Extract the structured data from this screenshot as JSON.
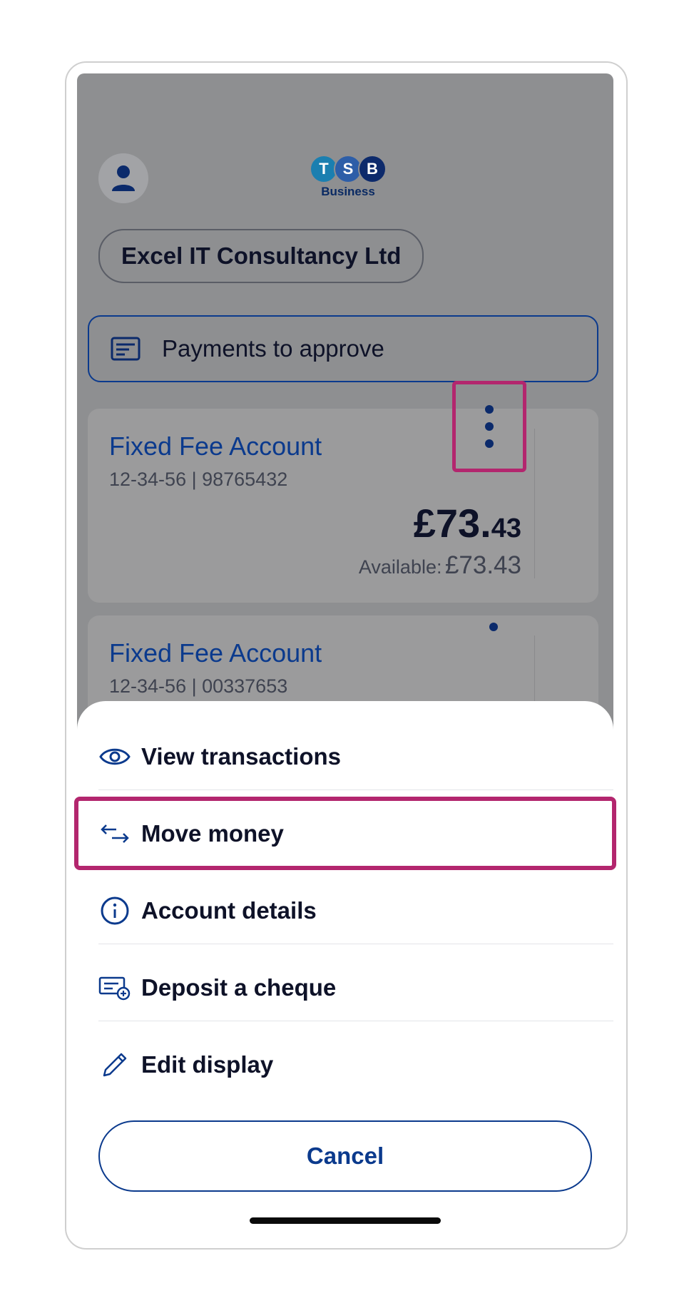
{
  "header": {
    "logo_letters": [
      "T",
      "S",
      "B"
    ],
    "logo_colors": [
      "#1b7fb0",
      "#2d5ea8",
      "#0d2a6b"
    ],
    "logo_sub": "Business",
    "company": "Excel IT Consultancy Ltd",
    "profile_icon": "person-icon"
  },
  "payments_button": {
    "label": "Payments to approve",
    "icon": "document-icon"
  },
  "accounts": [
    {
      "name": "Fixed Fee Account",
      "sort_account": "12-34-56 | 98765432",
      "balance_major": "£73.",
      "balance_minor": "43",
      "available_label": "Available:",
      "available_amount": "£73.43"
    },
    {
      "name": "Fixed Fee Account",
      "sort_account": "12-34-56 | 00337653"
    }
  ],
  "menu": {
    "items": [
      {
        "label": "View transactions",
        "icon": "eye-icon"
      },
      {
        "label": "Move money",
        "icon": "transfer-arrows-icon"
      },
      {
        "label": "Account details",
        "icon": "info-icon"
      },
      {
        "label": "Deposit a cheque",
        "icon": "cheque-add-icon"
      },
      {
        "label": "Edit display",
        "icon": "pencil-icon"
      }
    ],
    "cancel_label": "Cancel"
  },
  "colors": {
    "brand_blue": "#0b3a8d",
    "highlight": "#b3266e",
    "overlay": "#8e8f91"
  }
}
